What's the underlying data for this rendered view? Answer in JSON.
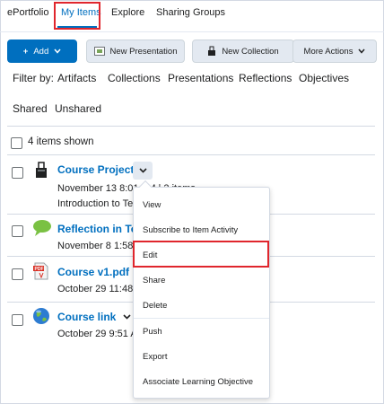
{
  "nav": {
    "tabs": [
      {
        "label": "ePortfolio"
      },
      {
        "label": "My Items"
      },
      {
        "label": "Explore"
      },
      {
        "label": "Sharing Groups"
      }
    ]
  },
  "toolbar": {
    "add_label": "Add",
    "new_presentation_label": "New Presentation",
    "new_collection_label": "New Collection",
    "more_actions_label": "More Actions"
  },
  "filter": {
    "label": "Filter by:",
    "options": [
      "Artifacts",
      "Collections",
      "Presentations",
      "Reflections",
      "Objectives",
      "Shared",
      "Unshared"
    ]
  },
  "list": {
    "count_text": "4 items shown",
    "items": [
      {
        "title": "Course Project",
        "line1": "November 13 8:01 AM | 2 items",
        "line2": "Introduction to Te",
        "icon": "binder-clip-icon"
      },
      {
        "title": "Reflection in Tec",
        "line1": "November 8 1:58",
        "icon": "speech-bubble-icon"
      },
      {
        "title": "Course v1.pdf",
        "line1": "October 29 11:48",
        "icon": "pdf-file-icon"
      },
      {
        "title": "Course link",
        "line1": "October 29 9:51 A",
        "icon": "globe-icon"
      }
    ]
  },
  "menu": {
    "items": [
      "View",
      "Subscribe to Item Activity",
      "Edit",
      "Share",
      "Delete",
      "Push",
      "Export",
      "Associate Learning Objective"
    ]
  },
  "colors": {
    "accent": "#006fbf",
    "highlight": "#e0262d",
    "button_grey": "#e3e9f1"
  }
}
